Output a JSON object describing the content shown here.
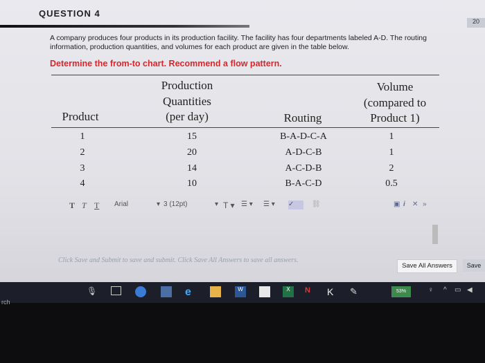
{
  "question": {
    "title": "QUESTION 4",
    "points": "20"
  },
  "intro": "A company produces four products in its production facility. The facility has four departments labeled A-D. The routing information, production quantities, and volumes for each product are given in the table below.",
  "task": "Determine the from-to chart. Recommend a flow pattern.",
  "table": {
    "headers": {
      "product": "Product",
      "quantities": [
        "Production",
        "Quantities",
        "(per day)"
      ],
      "routing": "Routing",
      "volume": [
        "Volume",
        "(compared to",
        "Product 1)"
      ]
    },
    "rows": [
      {
        "product": "1",
        "quantity": "15",
        "routing": "B-A-D-C-A",
        "volume": "1"
      },
      {
        "product": "2",
        "quantity": "20",
        "routing": "A-D-C-B",
        "volume": "1"
      },
      {
        "product": "3",
        "quantity": "14",
        "routing": "A-C-D-B",
        "volume": "2"
      },
      {
        "product": "4",
        "quantity": "10",
        "routing": "B-A-C-D",
        "volume": "0.5"
      }
    ]
  },
  "toolbar": {
    "font": "Arial",
    "size": "3 (12pt)"
  },
  "hint": "Click Save and Submit to save and submit. Click Save All Answers to save all answers.",
  "buttons": {
    "save_all": "Save All Answers",
    "save": "Save"
  },
  "taskbar": {
    "search_label": "rch",
    "badge": "53%"
  },
  "colors": {
    "accent_red": "#d8262b",
    "taskbar": "#1c1f29"
  }
}
